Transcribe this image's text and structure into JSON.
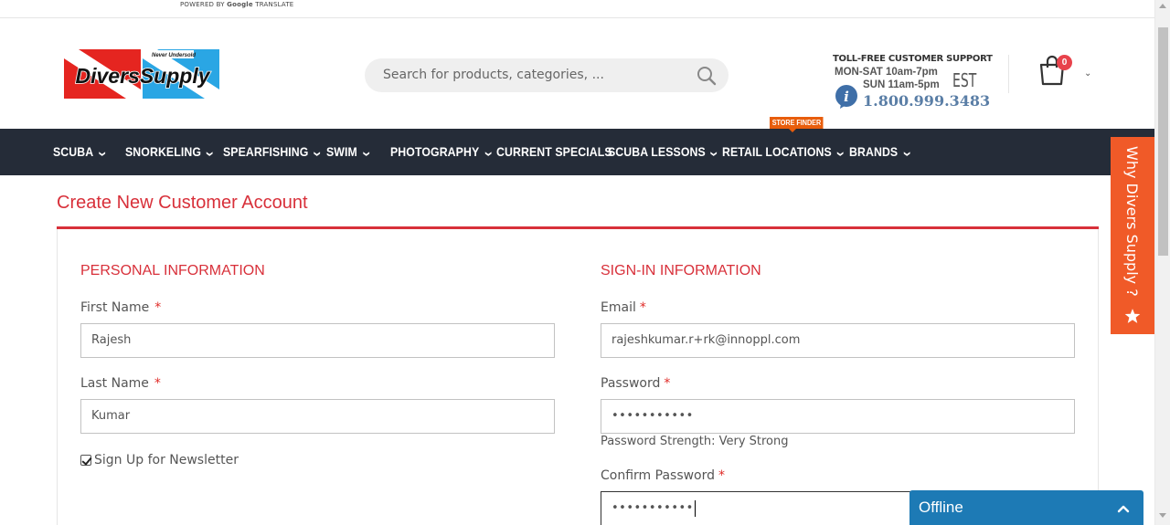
{
  "translate": {
    "powered_by": "POWERED BY",
    "google": "Google",
    "translate": "TRANSLATE"
  },
  "header": {
    "logo_alt": "Divers Supply",
    "logo_tagline": "Never Undersold",
    "search_placeholder": "Search for products, categories, ...",
    "support": {
      "title": "TOLL-FREE CUSTOMER SUPPORT",
      "hours_weekday": "MON-SAT 10am-7pm",
      "hours_sunday": "SUN 11am-5pm",
      "timezone": "EST",
      "phone": "1.800.999.3483"
    },
    "cart_count": "0"
  },
  "nav": {
    "items": [
      {
        "label": "SCUBA",
        "has_menu": true
      },
      {
        "label": "SNORKELING",
        "has_menu": true
      },
      {
        "label": "SPEARFISHING",
        "has_menu": true
      },
      {
        "label": "SWIM",
        "has_menu": true
      },
      {
        "label": "PHOTOGRAPHY",
        "has_menu": true
      },
      {
        "label": "CURRENT SPECIALS",
        "has_menu": false
      },
      {
        "label": "SCUBA LESSONS",
        "has_menu": true
      },
      {
        "label": "RETAIL LOCATIONS",
        "has_menu": true
      },
      {
        "label": "BRANDS",
        "has_menu": true
      }
    ],
    "store_finder_badge": "STORE FINDER"
  },
  "page": {
    "title": "Create New Customer Account",
    "personal": {
      "heading": "PERSONAL INFORMATION",
      "first_name_label": "First Name",
      "first_name_value": "Rajesh",
      "last_name_label": "Last Name",
      "last_name_value": "Kumar",
      "newsletter_label": "Sign Up for Newsletter",
      "newsletter_checked": true,
      "required_mark": "*"
    },
    "signin": {
      "heading": "SIGN-IN INFORMATION",
      "email_label": "Email",
      "email_value": "rajeshkumar.r+rk@innoppl.com",
      "password_label": "Password",
      "password_value": "•••••••••••",
      "password_strength": "Password Strength: Very Strong",
      "confirm_label": "Confirm Password",
      "confirm_value": "•••••••••••",
      "required_mark": "*"
    }
  },
  "side_tab": {
    "label": "Why Divers Supply ?"
  },
  "chat": {
    "status": "Offline"
  },
  "colors": {
    "accent": "#d8303a",
    "nav_bg": "#252c38",
    "side_tab": "#f05a28",
    "chat": "#1d7ab5"
  }
}
